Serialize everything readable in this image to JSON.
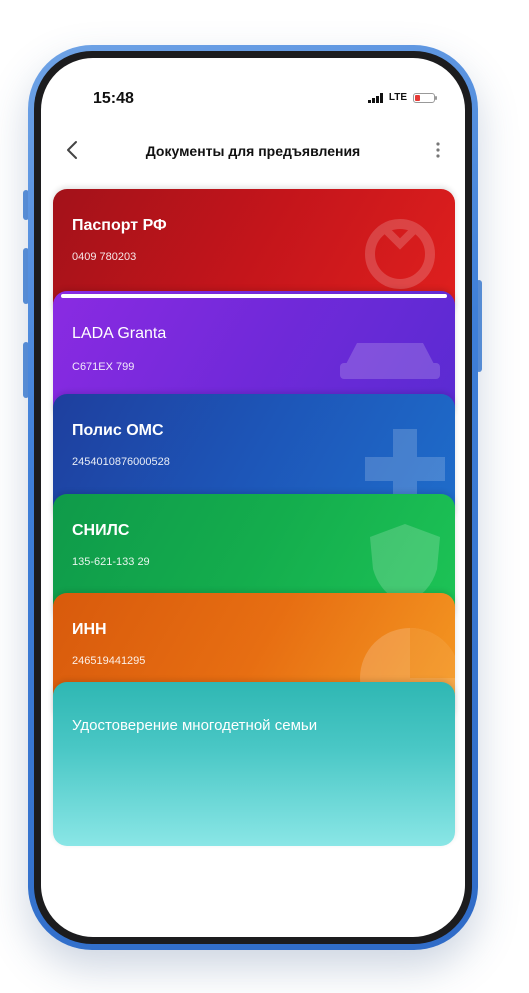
{
  "status_bar": {
    "time": "15:48",
    "network": "LTE"
  },
  "nav": {
    "title": "Документы для предъявления"
  },
  "cards": [
    {
      "title": "Паспорт РФ",
      "number": "0409 780203",
      "color": "#c4151b",
      "icon": "emblem-icon"
    },
    {
      "title": "LADA Granta",
      "number": "C671EX 799",
      "color": "#7129d9",
      "icon": "car-icon"
    },
    {
      "title": "Полис ОМС",
      "number": "2454010876000528",
      "color": "#1d56b8",
      "icon": "medical-cross-icon"
    },
    {
      "title": "СНИЛС",
      "number": "135-621-133 29",
      "color": "#14ad4d",
      "icon": "shield-icon"
    },
    {
      "title": "ИНН",
      "number": "246519441295",
      "color": "#e76e12",
      "icon": "pie-icon"
    },
    {
      "title": "Удостоверение многодетной семьи",
      "number": "",
      "color": "#49c7c5",
      "icon": ""
    }
  ],
  "colors": {
    "frame": "#3f7fd8",
    "battery_low": "#e53935"
  }
}
